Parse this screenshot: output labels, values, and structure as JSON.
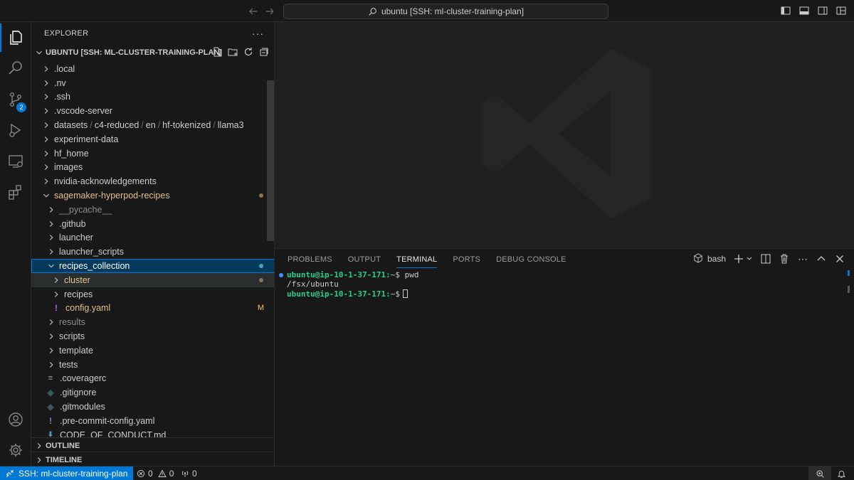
{
  "titlebar": {
    "command_center": "ubuntu [SSH: ml-cluster-training-plan]"
  },
  "activitybar": {
    "items": [
      "explorer-icon",
      "search-icon",
      "source-control-icon",
      "run-debug-icon",
      "remote-explorer-icon",
      "extensions-icon"
    ],
    "source_control_badge": "2"
  },
  "sidebar": {
    "title": "EXPLORER",
    "more": "···",
    "root_label": "UBUNTU [SSH: ML-CLUSTER-TRAINING-PLAN]",
    "tree": [
      {
        "label": ".local"
      },
      {
        "label": ".nv"
      },
      {
        "label": ".ssh"
      },
      {
        "label": ".vscode-server"
      },
      {
        "path": [
          "datasets",
          "c4-reduced",
          "en",
          "hf-tokenized",
          "llama3"
        ]
      },
      {
        "label": "experiment-data"
      },
      {
        "label": "hf_home"
      },
      {
        "label": "images"
      },
      {
        "label": "nvidia-acknowledgements"
      },
      {
        "label": "sagemaker-hyperpod-recipes"
      },
      {
        "label": "__pycache__"
      },
      {
        "label": ".github"
      },
      {
        "label": "launcher"
      },
      {
        "label": "launcher_scripts"
      },
      {
        "label": "recipes_collection"
      },
      {
        "label": "cluster"
      },
      {
        "label": "recipes"
      },
      {
        "label": "config.yaml",
        "badge": "M"
      },
      {
        "label": "results"
      },
      {
        "label": "scripts"
      },
      {
        "label": "template"
      },
      {
        "label": "tests"
      },
      {
        "label": ".coveragerc"
      },
      {
        "label": ".gitignore"
      },
      {
        "label": ".gitmodules"
      },
      {
        "label": ".pre-commit-config.yaml"
      },
      {
        "label": "CODE_OF_CONDUCT.md"
      }
    ],
    "outline_label": "OUTLINE",
    "timeline_label": "TIMELINE"
  },
  "panel": {
    "tabs": [
      "PROBLEMS",
      "OUTPUT",
      "TERMINAL",
      "PORTS",
      "DEBUG CONSOLE"
    ],
    "active_tab": "TERMINAL",
    "shell": "bash",
    "terminal": {
      "line1_prompt": "ubuntu@ip-10-1-37-171:",
      "line1_rest": "~$ pwd",
      "line2": "/fsx/ubuntu",
      "line3_prompt": "ubuntu@ip-10-1-37-171:",
      "line3_rest": "~$"
    }
  },
  "statusbar": {
    "remote": "SSH: ml-cluster-training-plan",
    "errors": "0",
    "warnings": "0",
    "ports": "0"
  },
  "colors": {
    "accent": "#0078d4",
    "modified_folder": "#e2c08d",
    "prompt_green": "#23d18b",
    "untracked_gray": "#8c8c8c"
  }
}
